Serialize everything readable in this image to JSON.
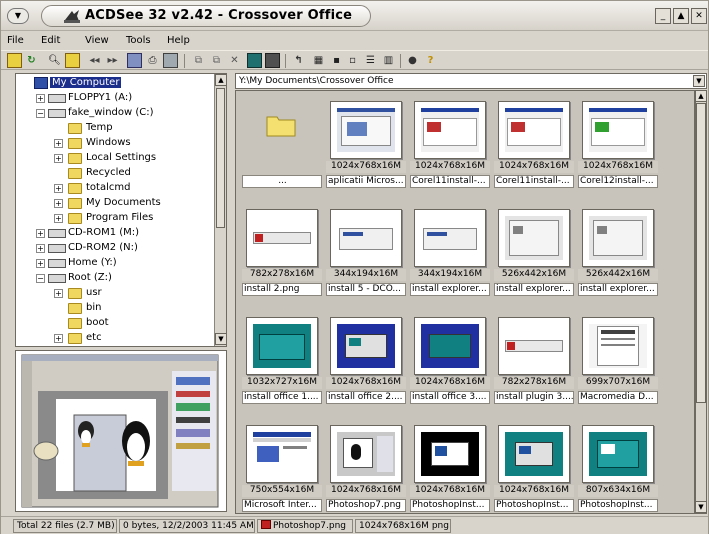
{
  "window": {
    "title": "ACDSee 32 v2.42 - Crossover Office"
  },
  "menu": {
    "items": [
      {
        "label": "File"
      },
      {
        "label": "Edit"
      },
      {
        "label": "View"
      },
      {
        "label": "Tools"
      },
      {
        "label": "Help"
      }
    ]
  },
  "toolbar": {
    "icons": [
      "browse-icon",
      "refresh-icon",
      "find-icon",
      "browse-up-icon",
      "back-icon",
      "forward-icon",
      "acquire-icon",
      "print-icon",
      "slideshow-icon",
      "copy-icon",
      "move-icon",
      "delete-icon",
      "wallpaper-icon",
      "edit-icon",
      "rotate-icon",
      "thumbnails-view-icon",
      "large-icons-view-icon",
      "small-icons-view-icon",
      "list-view-icon",
      "details-view-icon",
      "filter-icon",
      "help-icon"
    ]
  },
  "tree": {
    "items": [
      {
        "label": "My Computer",
        "selected": true
      },
      {
        "label": "FLOPPY1 (A:)"
      },
      {
        "label": "fake_window (C:)"
      },
      {
        "label": "Temp"
      },
      {
        "label": "Windows"
      },
      {
        "label": "Local Settings"
      },
      {
        "label": "Recycled"
      },
      {
        "label": "totalcmd"
      },
      {
        "label": "My Documents"
      },
      {
        "label": "Program Files"
      },
      {
        "label": "CD-ROM1 (M:)"
      },
      {
        "label": "CD-ROM2 (N:)"
      },
      {
        "label": "Home (Y:)"
      },
      {
        "label": "Root (Z:)"
      },
      {
        "label": "usr"
      },
      {
        "label": "bin"
      },
      {
        "label": "boot"
      },
      {
        "label": "etc"
      }
    ]
  },
  "path": {
    "value": "Y:\\My Documents\\Crossover Office"
  },
  "files": [
    {
      "dims": "",
      "name": "..."
    },
    {
      "dims": "1024x768x16M",
      "name": "aplicatii Micros..."
    },
    {
      "dims": "1024x768x16M",
      "name": "Corel11install-..."
    },
    {
      "dims": "1024x768x16M",
      "name": "Corel11install-..."
    },
    {
      "dims": "1024x768x16M",
      "name": "Corel12install-..."
    },
    {
      "dims": "782x278x16M",
      "name": "install 2.png"
    },
    {
      "dims": "344x194x16M",
      "name": "install 5 - DCO..."
    },
    {
      "dims": "344x194x16M",
      "name": "install explorer..."
    },
    {
      "dims": "526x442x16M",
      "name": "install explorer..."
    },
    {
      "dims": "526x442x16M",
      "name": "install explorer..."
    },
    {
      "dims": "1032x727x16M",
      "name": "install office 1...."
    },
    {
      "dims": "1024x768x16M",
      "name": "install office 2...."
    },
    {
      "dims": "1024x768x16M",
      "name": "install office 3...."
    },
    {
      "dims": "782x278x16M",
      "name": "install plugin 3...."
    },
    {
      "dims": "699x707x16M",
      "name": "Macromedia D..."
    },
    {
      "dims": "750x554x16M",
      "name": "Microsoft Inter..."
    },
    {
      "dims": "1024x768x16M",
      "name": "Photoshop7.png"
    },
    {
      "dims": "1024x768x16M",
      "name": "PhotoshopInst..."
    },
    {
      "dims": "1024x768x16M",
      "name": "PhotoshopInst..."
    },
    {
      "dims": "807x634x16M",
      "name": "PhotoshopInst..."
    }
  ],
  "status": {
    "total": "Total 22 files (2.7 MB)",
    "selection": "0 bytes, 12/2/2003 11:45 AM",
    "filename": "Photoshop7.png",
    "info": "1024x768x16M png"
  }
}
